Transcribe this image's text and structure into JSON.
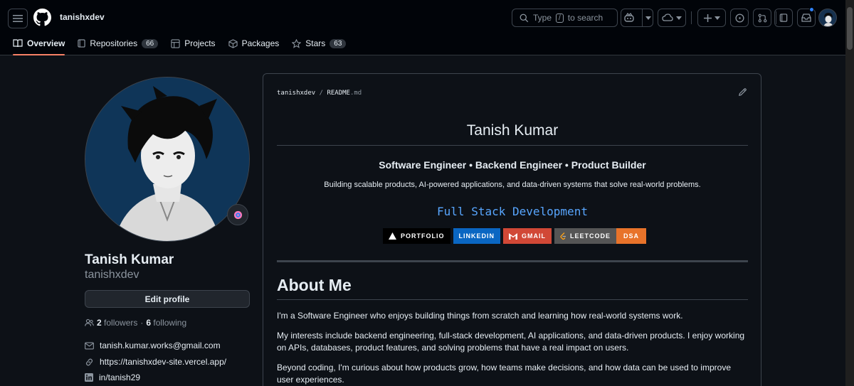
{
  "header": {
    "username": "tanishxdev",
    "search_prefix": "Type",
    "search_key": "/",
    "search_suffix": "to search",
    "notification_color": "#2f81f7"
  },
  "tabs": [
    {
      "label": "Overview",
      "icon": "book-icon",
      "active": true
    },
    {
      "label": "Repositories",
      "icon": "repo-icon",
      "count": "66"
    },
    {
      "label": "Projects",
      "icon": "table-icon"
    },
    {
      "label": "Packages",
      "icon": "package-icon"
    },
    {
      "label": "Stars",
      "icon": "star-icon",
      "count": "63"
    }
  ],
  "profile": {
    "name": "Tanish Kumar",
    "handle": "tanishxdev",
    "edit_label": "Edit profile",
    "followers_count": "2",
    "followers_label": "followers",
    "dot": "·",
    "following_count": "6",
    "following_label": "following",
    "email": "tanish.kumar.works@gmail.com",
    "website": "https://tanishxdev-site.vercel.app/",
    "linkedin": "in/tanish29"
  },
  "readme": {
    "owner": "tanishxdev",
    "sep": "/",
    "file": "README",
    "ext": ".md",
    "title": "Tanish Kumar",
    "subtitle": "Software Engineer • Backend Engineer • Product Builder",
    "tagline": "Building scalable products, AI-powered applications, and data-driven systems that solve real-world problems.",
    "stack": "Full Stack Development",
    "badges": [
      {
        "label": "PORTFOLIO",
        "color": "#000000"
      },
      {
        "label": "LINKEDIN",
        "color": "#0a66c2"
      },
      {
        "label": "GMAIL",
        "color": "#d14836"
      },
      {
        "label": "LEETCODE",
        "color": "#555555"
      },
      {
        "label": "DSA",
        "color": "#e8732a"
      }
    ],
    "about_heading": "About Me",
    "para1": "I'm a Software Engineer who enjoys building things from scratch and learning how real-world systems work.",
    "para2": "My interests include backend engineering, full-stack development, AI applications, and data-driven products. I enjoy working on APIs, databases, product features, and solving problems that have a real impact on users.",
    "para3": "Beyond coding, I'm curious about how products grow, how teams make decisions, and how data can be used to improve user experiences."
  }
}
